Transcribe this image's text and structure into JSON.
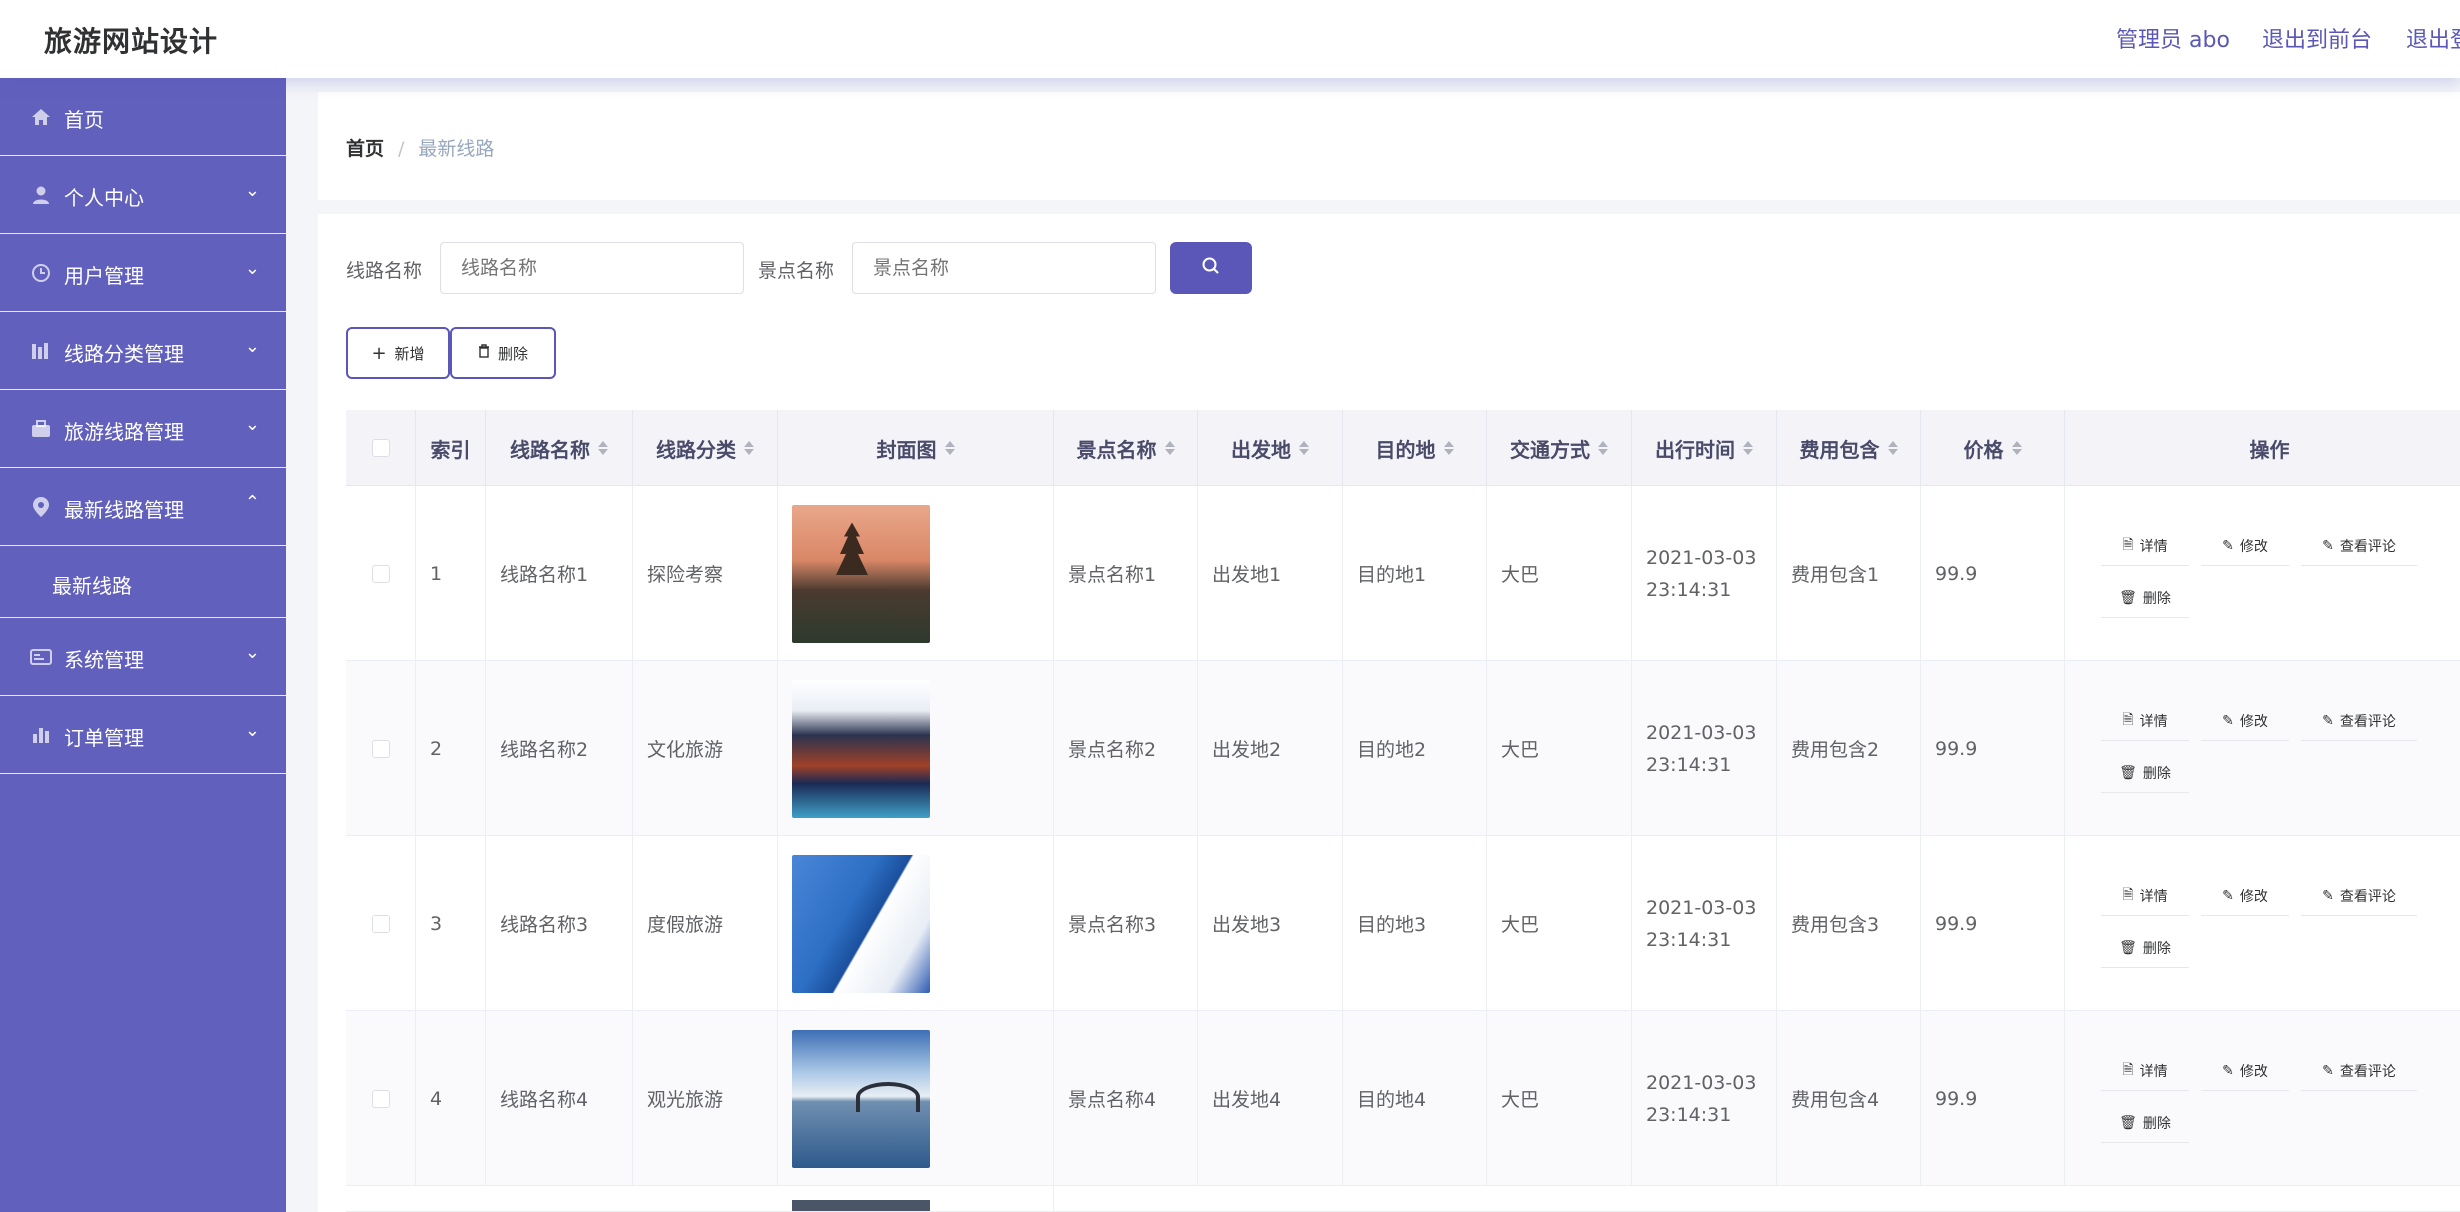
{
  "header": {
    "title": "旅游网站设计",
    "nav": [
      "管理员 abo",
      "退出到前台",
      "退出登录"
    ]
  },
  "sidebar": {
    "items": [
      {
        "label": "首页",
        "icon": "home-icon",
        "arrow": ""
      },
      {
        "label": "个人中心",
        "icon": "user-icon",
        "arrow": "⌄"
      },
      {
        "label": "用户管理",
        "icon": "clock-icon",
        "arrow": "⌄"
      },
      {
        "label": "线路分类管理",
        "icon": "bars-icon",
        "arrow": "⌄"
      },
      {
        "label": "旅游线路管理",
        "icon": "briefcase-icon",
        "arrow": "⌄"
      },
      {
        "label": "最新线路管理",
        "icon": "location-pin-icon",
        "arrow": "⌃"
      },
      {
        "label": "最新线路",
        "icon": "",
        "arrow": ""
      },
      {
        "label": "系统管理",
        "icon": "id-card-icon",
        "arrow": "⌄"
      },
      {
        "label": "订单管理",
        "icon": "chart-icon",
        "arrow": "⌄"
      }
    ]
  },
  "breadcrumb": {
    "home": "首页",
    "separator": "/",
    "current": "最新线路"
  },
  "search": {
    "route_label": "线路名称",
    "route_placeholder": "线路名称",
    "scenic_label": "景点名称",
    "scenic_placeholder": "景点名称"
  },
  "actions": {
    "add": "新增",
    "delete": "删除"
  },
  "table": {
    "headers": [
      "索引",
      "线路名称",
      "线路分类",
      "封面图",
      "景点名称",
      "出发地",
      "目的地",
      "交通方式",
      "出行时间",
      "费用包含",
      "价格",
      "操作"
    ],
    "row_actions": {
      "detail": "详情",
      "edit": "修改",
      "comments": "查看评论",
      "delete": "删除"
    },
    "rows": [
      {
        "index": "1",
        "route": "线路名称1",
        "category": "探险考察",
        "scenic": "景点名称1",
        "from": "出发地1",
        "to": "目的地1",
        "transport": "大巴",
        "date": "2021-03-03",
        "time": "23:14:31",
        "fee": "费用包含1",
        "price": "99.9"
      },
      {
        "index": "2",
        "route": "线路名称2",
        "category": "文化旅游",
        "scenic": "景点名称2",
        "from": "出发地2",
        "to": "目的地2",
        "transport": "大巴",
        "date": "2021-03-03",
        "time": "23:14:31",
        "fee": "费用包含2",
        "price": "99.9"
      },
      {
        "index": "3",
        "route": "线路名称3",
        "category": "度假旅游",
        "scenic": "景点名称3",
        "from": "出发地3",
        "to": "目的地3",
        "transport": "大巴",
        "date": "2021-03-03",
        "time": "23:14:31",
        "fee": "费用包含3",
        "price": "99.9"
      },
      {
        "index": "4",
        "route": "线路名称4",
        "category": "观光旅游",
        "scenic": "景点名称4",
        "from": "出发地4",
        "to": "目的地4",
        "transport": "大巴",
        "date": "2021-03-03",
        "time": "23:14:31",
        "fee": "费用包含4",
        "price": "99.9"
      }
    ]
  },
  "colors": {
    "accent": "#5b57b8",
    "sidebar": "#6160bd"
  }
}
